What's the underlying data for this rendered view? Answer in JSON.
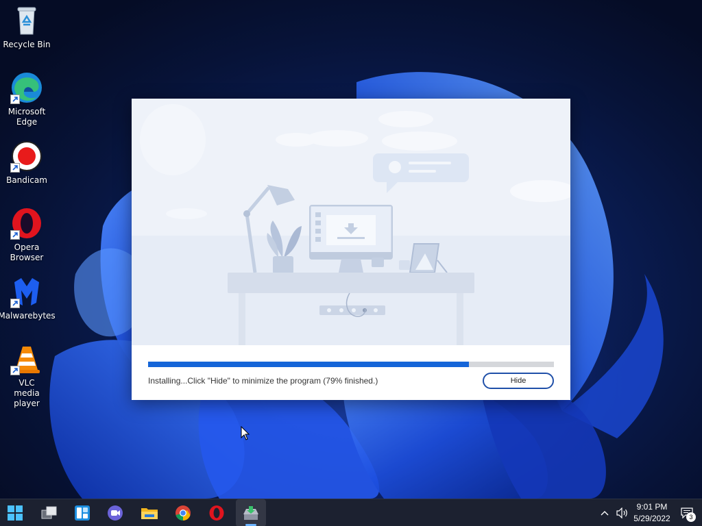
{
  "desktop": {
    "icons": [
      {
        "label": "Recycle Bin",
        "icon": "recycle-bin-icon"
      },
      {
        "label": "Microsoft Edge",
        "icon": "edge-icon"
      },
      {
        "label": "Bandicam",
        "icon": "bandicam-icon"
      },
      {
        "label": "Opera Browser",
        "icon": "opera-icon"
      },
      {
        "label": "Malwarebytes",
        "icon": "malwarebytes-icon"
      },
      {
        "label": "VLC media player",
        "icon": "vlc-icon"
      }
    ]
  },
  "installer": {
    "progress": 0.79,
    "status_text": "Installing...Click \"Hide\" to minimize the program (79% finished.)",
    "hide_label": "Hide"
  },
  "taskbar": {
    "items": [
      {
        "icon": "start-icon"
      },
      {
        "icon": "task-view-icon"
      },
      {
        "icon": "widgets-icon"
      },
      {
        "icon": "teams-chat-icon"
      },
      {
        "icon": "file-explorer-icon"
      },
      {
        "icon": "chrome-icon"
      },
      {
        "icon": "opera-icon"
      },
      {
        "icon": "installer-app-icon"
      }
    ],
    "clock": {
      "time": "9:01 PM",
      "date": "5/29/2022"
    },
    "notification_count": "3"
  },
  "colors": {
    "accent": "#1565d8",
    "taskbar": "#1c2130",
    "desktop_dark": "#071338"
  }
}
